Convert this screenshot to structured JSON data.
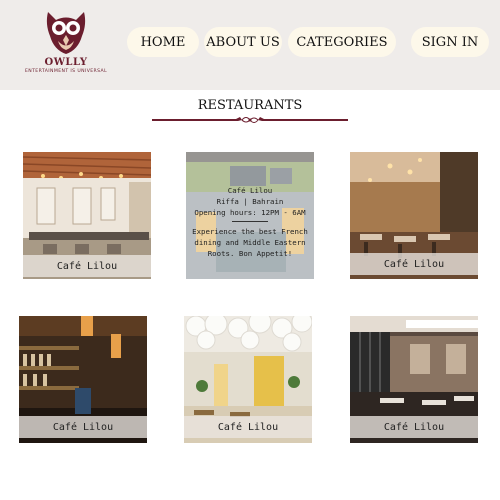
{
  "brand": {
    "name": "OWLLY",
    "tagline": "ENTERTAINMENT IS UNIVERSAL",
    "color": "#6b1e2e"
  },
  "nav": {
    "home": "HOME",
    "about": "ABOUT US",
    "categories": "CATEGORIES",
    "signin": "SIGN IN"
  },
  "section": {
    "title": "RESTAURANTS"
  },
  "cards": [
    {
      "caption": "Café Lilou"
    },
    {
      "caption": "Café Lilou",
      "overlay": {
        "name": "Café Lilou",
        "location": "Riffa | Bahrain",
        "hours": "Opening hours: 12PM - 6AM",
        "desc_line1": "Experience the best French",
        "desc_line2": "dining and Middle Eastern",
        "desc_line3": "Roots. Bon Appetit!"
      }
    },
    {
      "caption": "Café Lilou"
    },
    {
      "caption": "Café Lilou"
    },
    {
      "caption": "Café Lilou"
    },
    {
      "caption": "Café Lilou"
    }
  ]
}
